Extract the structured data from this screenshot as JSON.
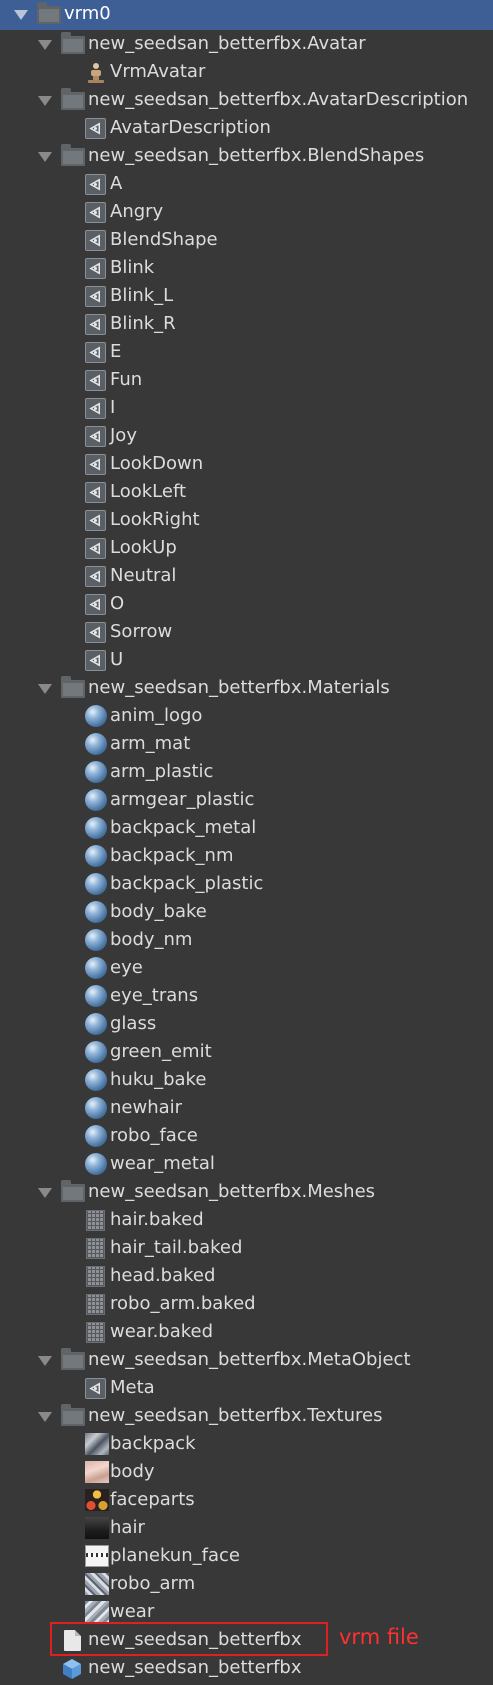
{
  "tree": [
    {
      "level": 0,
      "icon": "folder-icon",
      "expanded": true,
      "selected": true,
      "label": "vrm0"
    },
    {
      "level": 1,
      "icon": "folder-icon",
      "expanded": true,
      "label": "new_seedsan_betterfbx.Avatar"
    },
    {
      "level": 2,
      "icon": "avatar-icon",
      "label": "VrmAvatar"
    },
    {
      "level": 1,
      "icon": "folder-icon",
      "expanded": true,
      "label": "new_seedsan_betterfbx.AvatarDescription"
    },
    {
      "level": 2,
      "icon": "unity-asset-icon",
      "label": "AvatarDescription"
    },
    {
      "level": 1,
      "icon": "folder-icon",
      "expanded": true,
      "label": "new_seedsan_betterfbx.BlendShapes"
    },
    {
      "level": 2,
      "icon": "unity-asset-icon",
      "label": "A"
    },
    {
      "level": 2,
      "icon": "unity-asset-icon",
      "label": "Angry"
    },
    {
      "level": 2,
      "icon": "unity-asset-icon",
      "label": "BlendShape"
    },
    {
      "level": 2,
      "icon": "unity-asset-icon",
      "label": "Blink"
    },
    {
      "level": 2,
      "icon": "unity-asset-icon",
      "label": "Blink_L"
    },
    {
      "level": 2,
      "icon": "unity-asset-icon",
      "label": "Blink_R"
    },
    {
      "level": 2,
      "icon": "unity-asset-icon",
      "label": "E"
    },
    {
      "level": 2,
      "icon": "unity-asset-icon",
      "label": "Fun"
    },
    {
      "level": 2,
      "icon": "unity-asset-icon",
      "label": "I"
    },
    {
      "level": 2,
      "icon": "unity-asset-icon",
      "label": "Joy"
    },
    {
      "level": 2,
      "icon": "unity-asset-icon",
      "label": "LookDown"
    },
    {
      "level": 2,
      "icon": "unity-asset-icon",
      "label": "LookLeft"
    },
    {
      "level": 2,
      "icon": "unity-asset-icon",
      "label": "LookRight"
    },
    {
      "level": 2,
      "icon": "unity-asset-icon",
      "label": "LookUp"
    },
    {
      "level": 2,
      "icon": "unity-asset-icon",
      "label": "Neutral"
    },
    {
      "level": 2,
      "icon": "unity-asset-icon",
      "label": "O"
    },
    {
      "level": 2,
      "icon": "unity-asset-icon",
      "label": "Sorrow"
    },
    {
      "level": 2,
      "icon": "unity-asset-icon",
      "label": "U"
    },
    {
      "level": 1,
      "icon": "folder-icon",
      "expanded": true,
      "label": "new_seedsan_betterfbx.Materials"
    },
    {
      "level": 2,
      "icon": "material-sphere-icon",
      "label": "anim_logo"
    },
    {
      "level": 2,
      "icon": "material-sphere-icon",
      "label": "arm_mat"
    },
    {
      "level": 2,
      "icon": "material-sphere-icon",
      "label": "arm_plastic"
    },
    {
      "level": 2,
      "icon": "material-sphere-icon",
      "label": "armgear_plastic"
    },
    {
      "level": 2,
      "icon": "material-sphere-icon",
      "label": "backpack_metal"
    },
    {
      "level": 2,
      "icon": "material-sphere-icon",
      "label": "backpack_nm"
    },
    {
      "level": 2,
      "icon": "material-sphere-icon",
      "label": "backpack_plastic"
    },
    {
      "level": 2,
      "icon": "material-sphere-icon",
      "label": "body_bake"
    },
    {
      "level": 2,
      "icon": "material-sphere-icon",
      "label": "body_nm"
    },
    {
      "level": 2,
      "icon": "material-sphere-icon",
      "label": "eye"
    },
    {
      "level": 2,
      "icon": "material-sphere-icon",
      "label": "eye_trans"
    },
    {
      "level": 2,
      "icon": "material-sphere-icon",
      "label": "glass"
    },
    {
      "level": 2,
      "icon": "material-sphere-icon",
      "label": "green_emit"
    },
    {
      "level": 2,
      "icon": "material-sphere-icon",
      "label": "huku_bake"
    },
    {
      "level": 2,
      "icon": "material-sphere-icon",
      "label": "newhair"
    },
    {
      "level": 2,
      "icon": "material-sphere-icon",
      "label": "robo_face"
    },
    {
      "level": 2,
      "icon": "material-sphere-icon",
      "label": "wear_metal"
    },
    {
      "level": 1,
      "icon": "folder-icon",
      "expanded": true,
      "label": "new_seedsan_betterfbx.Meshes"
    },
    {
      "level": 2,
      "icon": "mesh-icon",
      "label": "hair.baked"
    },
    {
      "level": 2,
      "icon": "mesh-icon",
      "label": "hair_tail.baked"
    },
    {
      "level": 2,
      "icon": "mesh-icon",
      "label": "head.baked"
    },
    {
      "level": 2,
      "icon": "mesh-icon",
      "label": "robo_arm.baked"
    },
    {
      "level": 2,
      "icon": "mesh-icon",
      "label": "wear.baked"
    },
    {
      "level": 1,
      "icon": "folder-icon",
      "expanded": true,
      "label": "new_seedsan_betterfbx.MetaObject"
    },
    {
      "level": 2,
      "icon": "unity-asset-icon",
      "label": "Meta"
    },
    {
      "level": 1,
      "icon": "folder-icon",
      "expanded": true,
      "label": "new_seedsan_betterfbx.Textures"
    },
    {
      "level": 2,
      "icon": "texture-backpack-icon",
      "label": "backpack"
    },
    {
      "level": 2,
      "icon": "texture-body-icon",
      "label": "body"
    },
    {
      "level": 2,
      "icon": "texture-faceparts-icon",
      "label": "faceparts"
    },
    {
      "level": 2,
      "icon": "texture-hair-icon",
      "label": "hair"
    },
    {
      "level": 2,
      "icon": "texture-planekun-icon",
      "label": "planekun_face"
    },
    {
      "level": 2,
      "icon": "texture-roboarm-icon",
      "label": "robo_arm"
    },
    {
      "level": 2,
      "icon": "texture-wear-icon",
      "label": "wear"
    },
    {
      "level": 1,
      "icon": "document-icon",
      "label": "new_seedsan_betterfbx"
    },
    {
      "level": 1,
      "icon": "prefab-cube-icon",
      "label": "new_seedsan_betterfbx"
    }
  ],
  "annotation": {
    "text": "vrm file",
    "color": "#ff3030"
  },
  "colors": {
    "background": "#383838",
    "selection": "#3e5f96",
    "text": "#dcdcdc",
    "highlight_border": "#e02020"
  }
}
